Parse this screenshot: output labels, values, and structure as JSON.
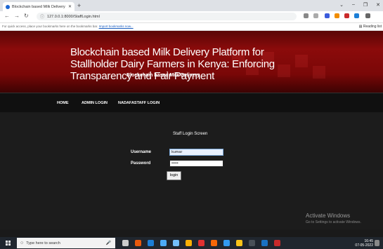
{
  "browser": {
    "tab_title": "Blockchain based Milk Delivery",
    "url": "127.0.0.1:8000/StaffLogin.html",
    "bookmark_hint": "For quick access, place your bookmarks here on the bookmarks bar.",
    "bookmark_link": "Import bookmarks now...",
    "reading_list": "Reading list"
  },
  "banner": {
    "title": "Blockchain based Milk Delivery Platform for Stallholder Dairy Farmers in Kenya: Enforcing Transparency and Fair Payment",
    "subtitle": "Blockchain based Milk Delivery"
  },
  "nav": {
    "home": "HOME",
    "admin_login": "ADMIN LOGIN",
    "nadafastaff_login": "NADAFASTAFF LOGIN"
  },
  "form": {
    "screen_title": "Staff Login Screen",
    "username_label": "Username",
    "username_value": "kumar",
    "password_label": "Password",
    "password_value": "•••••",
    "login_button": "login"
  },
  "watermark": {
    "title": "Activate Windows",
    "subtitle": "Go to Settings to activate Windows."
  },
  "taskbar": {
    "search_placeholder": "Type here to search",
    "time": "16:45",
    "date": "07-05-2022"
  }
}
